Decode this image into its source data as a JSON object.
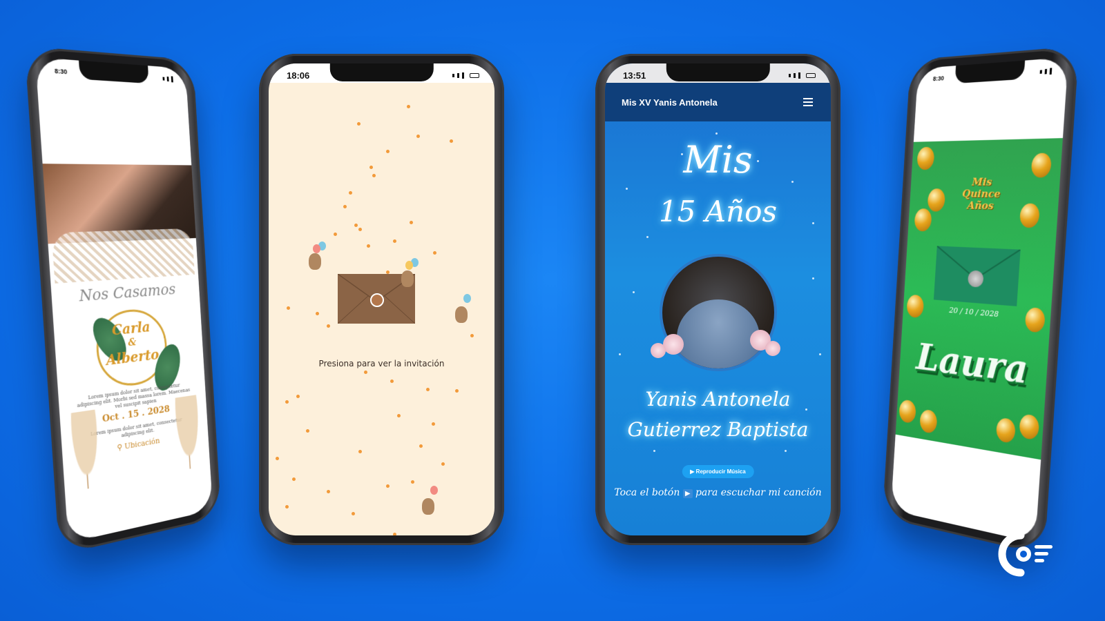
{
  "phone_1": {
    "time": "8:30",
    "title": "Nos Casamos",
    "name_1": "Carla",
    "ampersand": "&",
    "name_2": "Alberto",
    "lorem_1": "Lorem ipsum dolor sit amet, consectetur adipiscing elit. Morbi sed massa lorem. Maecenas vel suscipit sapien",
    "date": "Oct . 15 . 2028",
    "lorem_2": "Lorem ipsum dolor sit amet, consectetur adipiscing elit.",
    "location": "Ubicación"
  },
  "phone_2": {
    "time": "18:06",
    "prompt": "Presiona para ver la invitación"
  },
  "phone_3": {
    "time": "13:51",
    "nav_title": "Mis XV Yanis Antonela",
    "heading_1": "Mis",
    "heading_2": "15 Años",
    "name_line_1": "Yanis Antonela",
    "name_line_2": "Gutierrez Baptista",
    "music_button": "▶ Reproducir Música",
    "hint_before": "Toca el botón",
    "hint_after": "para escuchar mi canción"
  },
  "phone_4": {
    "time": "8:30",
    "logo_line_1": "Mis",
    "logo_line_2": "Quince",
    "logo_line_3": "Años",
    "date": "20 / 10 / 2028",
    "name": "Laura"
  },
  "colors": {
    "background": "#0d6ee8",
    "wedding_gold": "#d99a2b",
    "envelope_brown": "#8b6446",
    "quince_blue": "#1c8ee0",
    "quince_green": "#2cbb56"
  }
}
